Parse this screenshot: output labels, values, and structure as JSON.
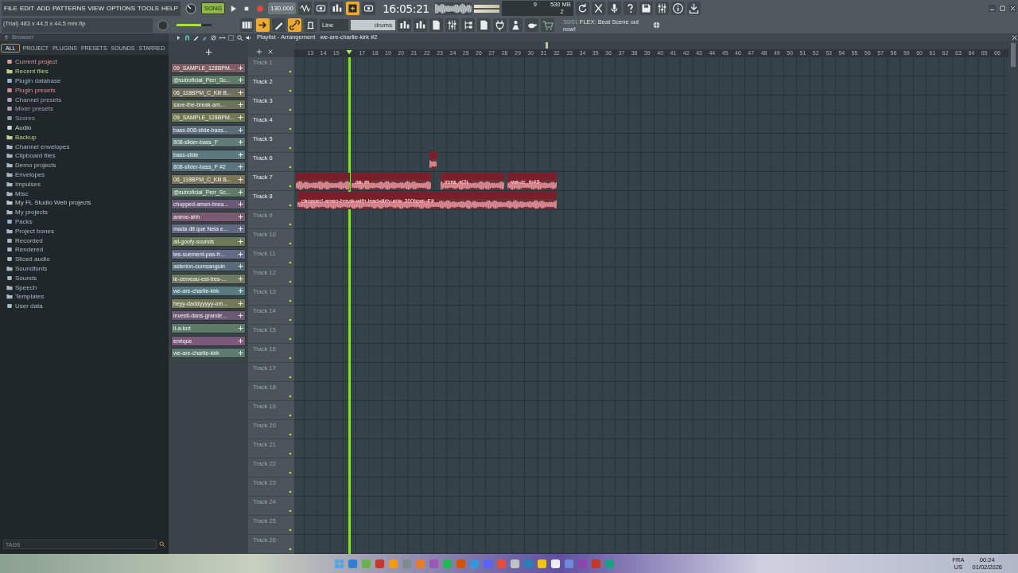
{
  "menu": [
    "FILE",
    "EDIT",
    "ADD",
    "PATTERNS",
    "VIEW",
    "OPTIONS",
    "TOOLS",
    "HELP"
  ],
  "hint": "(Trial) 483 x 44,5 x 44,5 mm.flp",
  "song_mode": {
    "label": "SONG",
    "on": true
  },
  "tempo": "130,000",
  "time": "16:05:21",
  "master_volume": {
    "level": 0.7
  },
  "monitor": {
    "cpu": "9",
    "ram": "530 MB",
    "polyphony": "2"
  },
  "snap": "Line",
  "pattern": "drums",
  "news": {
    "date": "30/01",
    "text": "FLEX: Beat Scene out now!"
  },
  "browser": {
    "title": "Browser",
    "tabs": [
      {
        "label": "ALL",
        "selected": true
      },
      {
        "label": "PROJECT",
        "selected": false
      },
      {
        "label": "PLUGINS",
        "selected": false
      },
      {
        "label": "PRESETS",
        "selected": false
      },
      {
        "label": "SOUNDS",
        "selected": false
      },
      {
        "label": "STARRED",
        "selected": false
      }
    ],
    "items": [
      {
        "label": "Current project",
        "kind": "item",
        "color": "#d99a9a"
      },
      {
        "label": "Recent files",
        "kind": "folder",
        "color": "#b8d08a"
      },
      {
        "label": "Plugin database",
        "kind": "item",
        "color": "#9fb0cc"
      },
      {
        "label": "Plugin presets",
        "kind": "item",
        "color": "#d58a9a"
      },
      {
        "label": "Channel presets",
        "kind": "item",
        "color": "#b79cc8"
      },
      {
        "label": "Mixer presets",
        "kind": "item",
        "color": "#b09ab8"
      },
      {
        "label": "Scores",
        "kind": "item",
        "color": "#8c9ca8"
      },
      {
        "label": "Audio",
        "kind": "item",
        "color": "#c8d0d6"
      },
      {
        "label": "Backup",
        "kind": "folder",
        "color": "#b8d08a"
      },
      {
        "label": "Channel envelopes",
        "kind": "folder",
        "color": "#a8b8c2"
      },
      {
        "label": "Clipboard files",
        "kind": "folder",
        "color": "#a8b8c2"
      },
      {
        "label": "Demo projects",
        "kind": "folder",
        "color": "#a8b8c2"
      },
      {
        "label": "Envelopes",
        "kind": "folder",
        "color": "#a8b8c2"
      },
      {
        "label": "Impulses",
        "kind": "folder",
        "color": "#a8b8c2"
      },
      {
        "label": "Misc",
        "kind": "folder",
        "color": "#a8b8c2"
      },
      {
        "label": "My FL Studio Web projects",
        "kind": "folder",
        "color": "#b8c8d2"
      },
      {
        "label": "My projects",
        "kind": "folder",
        "color": "#a8b8c2"
      },
      {
        "label": "Packs",
        "kind": "item",
        "color": "#9fb0d8"
      },
      {
        "label": "Project bones",
        "kind": "folder",
        "color": "#a8b8c2"
      },
      {
        "label": "Recorded",
        "kind": "item",
        "color": "#a8b8c2"
      },
      {
        "label": "Rendered",
        "kind": "item",
        "color": "#a8b8c2"
      },
      {
        "label": "Sliced audio",
        "kind": "item",
        "color": "#a8b8c2"
      },
      {
        "label": "Soundfonts",
        "kind": "folder",
        "color": "#a8b8c2"
      },
      {
        "label": "Sounds",
        "kind": "item",
        "color": "#a8b8c2"
      },
      {
        "label": "Speech",
        "kind": "folder",
        "color": "#a8b8c2"
      },
      {
        "label": "Templates",
        "kind": "folder",
        "color": "#a8b8c2"
      },
      {
        "label": "User data",
        "kind": "item",
        "color": "#a8b8c2"
      }
    ],
    "tags_placeholder": "TAGS"
  },
  "channels": [
    {
      "name": "09_SAMPLE_128BPM...",
      "color": "#7a5c62"
    },
    {
      "name": "@sutroficial_Perr_Sc...",
      "color": "#5f7a66"
    },
    {
      "name": "06_118BPM_C_Kill B...",
      "color": "#706f5c"
    },
    {
      "name": "save-the-break-am...",
      "color": "#6b7358"
    },
    {
      "name": "09_SAMPLE_128BPM...",
      "color": "#6f7a52"
    },
    {
      "name": "bass-808-slide-bass...",
      "color": "#5a6b7a"
    },
    {
      "name": "808-slider-bass_F",
      "color": "#607a75"
    },
    {
      "name": "bass-slide",
      "color": "#5a7a80"
    },
    {
      "name": "808-slider-bass_F #2",
      "color": "#5a7580"
    },
    {
      "name": "06_118BPM_C_Kill B...",
      "color": "#7a7558"
    },
    {
      "name": "@sutroficial_Perr_Sc...",
      "color": "#5f7a68"
    },
    {
      "name": "chopped-amen-brea...",
      "color": "#6a5a78"
    },
    {
      "name": "anime-ahh",
      "color": "#7a5a70"
    },
    {
      "name": "mada dit que Nela e...",
      "color": "#626a82"
    },
    {
      "name": "all-goofy-sounds",
      "color": "#6b7a58"
    },
    {
      "name": "tes-suement-pas-fr...",
      "color": "#646b84"
    },
    {
      "name": "asterion-cumsanguin",
      "color": "#5a6b78"
    },
    {
      "name": "le-cerveau-est-tres-...",
      "color": "#6f7a60"
    },
    {
      "name": "we-are-charlie-kirk",
      "color": "#5a7a80"
    },
    {
      "name": "heyy-daddyyyyy-om...",
      "color": "#737a5a"
    },
    {
      "name": "investi-dans-grande...",
      "color": "#6a5a72"
    },
    {
      "name": "il-a-tort",
      "color": "#607a6a"
    },
    {
      "name": "enrique",
      "color": "#7a5a78"
    },
    {
      "name": "we-are-charlie-kirk",
      "color": "#5f7a70"
    }
  ],
  "playlist": {
    "breadcrumb": [
      "Playlist - Arrangement",
      "we-are-charlie-kirk #2"
    ],
    "ruler_before": [
      "13",
      "14",
      "15"
    ],
    "ruler_after": [
      "17",
      "18",
      "19",
      "20",
      "21",
      "22",
      "23",
      "24",
      "25",
      "26",
      "27",
      "28",
      "29",
      "30",
      "31",
      "32",
      "33",
      "34",
      "35",
      "36",
      "37",
      "38",
      "39",
      "40",
      "41",
      "42",
      "43",
      "44",
      "45",
      "46",
      "47",
      "48",
      "49",
      "50",
      "51",
      "52",
      "53",
      "54",
      "55",
      "56",
      "57",
      "58",
      "59",
      "60",
      "61",
      "62",
      "63",
      "64",
      "65",
      "66"
    ],
    "tracks": [
      {
        "name": "Track 1",
        "dimmed": true
      },
      {
        "name": "Track 2",
        "dimmed": false
      },
      {
        "name": "Track 3",
        "dimmed": false
      },
      {
        "name": "Track 4",
        "dimmed": false
      },
      {
        "name": "Track 5",
        "dimmed": false
      },
      {
        "name": "Track 6",
        "dimmed": false,
        "clips": [
          {
            "kind": "audio"
          }
        ]
      },
      {
        "name": "Track 7",
        "dimmed": false,
        "clips": [
          {
            "kind": "audio"
          },
          {
            "kind": "audio",
            "label": "as_m"
          },
          {
            "kind": "audio",
            "label": "imes_r(3)"
          },
          {
            "kind": "audio",
            "label": "we-ar_rt #2"
          }
        ]
      },
      {
        "name": "Track 8",
        "dimmed": false,
        "clips": [
          {
            "kind": "audio",
            "label": "chopped-amen-break-with-lead-dirty-mix_200bpm_F#"
          }
        ]
      },
      {
        "name": "Track 9",
        "dimmed": true
      },
      {
        "name": "Track 10",
        "dimmed": true
      },
      {
        "name": "Track 11",
        "dimmed": true
      },
      {
        "name": "Track 12",
        "dimmed": true
      },
      {
        "name": "Track 13",
        "dimmed": true
      },
      {
        "name": "Track 14",
        "dimmed": true
      },
      {
        "name": "Track 15",
        "dimmed": true
      },
      {
        "name": "Track 16",
        "dimmed": true
      },
      {
        "name": "Track 17",
        "dimmed": true
      },
      {
        "name": "Track 18",
        "dimmed": true
      },
      {
        "name": "Track 19",
        "dimmed": true
      },
      {
        "name": "Track 20",
        "dimmed": true
      },
      {
        "name": "Track 21",
        "dimmed": true
      },
      {
        "name": "Track 22",
        "dimmed": true
      },
      {
        "name": "Track 23",
        "dimmed": true
      },
      {
        "name": "Track 24",
        "dimmed": true
      },
      {
        "name": "Track 25",
        "dimmed": true
      },
      {
        "name": "Track 26",
        "dimmed": true
      }
    ]
  },
  "taskbar": {
    "language": "FRA",
    "layout": "US",
    "clock": "00:24",
    "date": "01/02/2026"
  }
}
